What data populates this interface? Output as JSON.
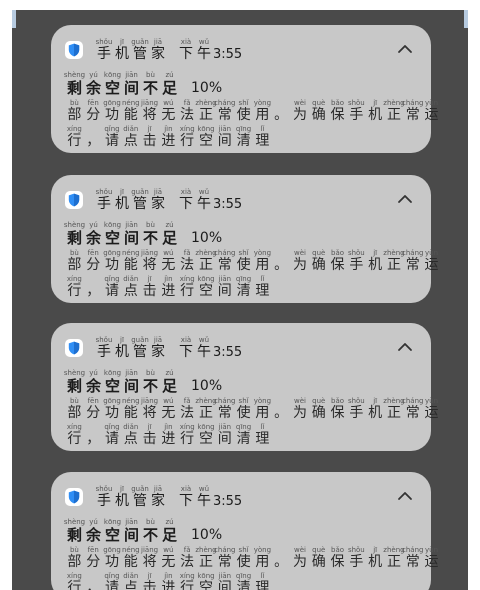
{
  "notifications": [
    {
      "app_name_chars": [
        {
          "py": "shǒu",
          "hz": "手"
        },
        {
          "py": "jī",
          "hz": "机"
        },
        {
          "py": "guǎn",
          "hz": "管"
        },
        {
          "py": "jiā",
          "hz": "家"
        }
      ],
      "time_prefix_chars": [
        {
          "py": "xià",
          "hz": "下"
        },
        {
          "py": "wǔ",
          "hz": "午"
        }
      ],
      "time": "3:55",
      "title_chars": [
        {
          "py": "shèng",
          "hz": "剩"
        },
        {
          "py": "yú",
          "hz": "余"
        },
        {
          "py": "kōng",
          "hz": "空"
        },
        {
          "py": "jiān",
          "hz": "间"
        },
        {
          "py": "bù",
          "hz": "不"
        },
        {
          "py": "zú",
          "hz": "足"
        }
      ],
      "title_value": "10%",
      "body_line1": [
        {
          "py": "bù",
          "hz": "部"
        },
        {
          "py": "fēn",
          "hz": "分"
        },
        {
          "py": "gōng",
          "hz": "功"
        },
        {
          "py": "néng",
          "hz": "能"
        },
        {
          "py": "jiāng",
          "hz": "将"
        },
        {
          "py": "wú",
          "hz": "无"
        },
        {
          "py": "fǎ",
          "hz": "法"
        },
        {
          "py": "zhèng",
          "hz": "正"
        },
        {
          "py": "cháng",
          "hz": "常"
        },
        {
          "py": "shǐ",
          "hz": "使"
        },
        {
          "py": "yòng",
          "hz": "用"
        },
        {
          "py": "",
          "hz": "。"
        },
        {
          "py": "wèi",
          "hz": "为"
        },
        {
          "py": "què",
          "hz": "确"
        },
        {
          "py": "bǎo",
          "hz": "保"
        },
        {
          "py": "shǒu",
          "hz": "手"
        },
        {
          "py": "jī",
          "hz": "机"
        },
        {
          "py": "zhèng",
          "hz": "正"
        },
        {
          "py": "cháng",
          "hz": "常"
        },
        {
          "py": "yùn",
          "hz": "运"
        }
      ],
      "body_line2": [
        {
          "py": "xíng",
          "hz": "行"
        },
        {
          "py": "",
          "hz": "，"
        },
        {
          "py": "qǐng",
          "hz": "请"
        },
        {
          "py": "diǎn",
          "hz": "点"
        },
        {
          "py": "jī",
          "hz": "击"
        },
        {
          "py": "jìn",
          "hz": "进"
        },
        {
          "py": "xíng",
          "hz": "行"
        },
        {
          "py": "kōng",
          "hz": "空"
        },
        {
          "py": "jiān",
          "hz": "间"
        },
        {
          "py": "qīng",
          "hz": "清"
        },
        {
          "py": "lǐ",
          "hz": "理"
        }
      ]
    },
    {
      "app_name_chars": [
        {
          "py": "shǒu",
          "hz": "手"
        },
        {
          "py": "jī",
          "hz": "机"
        },
        {
          "py": "guǎn",
          "hz": "管"
        },
        {
          "py": "jiā",
          "hz": "家"
        }
      ],
      "time_prefix_chars": [
        {
          "py": "xià",
          "hz": "下"
        },
        {
          "py": "wǔ",
          "hz": "午"
        }
      ],
      "time": "3:55",
      "title_chars": [
        {
          "py": "shèng",
          "hz": "剩"
        },
        {
          "py": "yú",
          "hz": "余"
        },
        {
          "py": "kōng",
          "hz": "空"
        },
        {
          "py": "jiān",
          "hz": "间"
        },
        {
          "py": "bù",
          "hz": "不"
        },
        {
          "py": "zú",
          "hz": "足"
        }
      ],
      "title_value": "10%",
      "body_line1": [
        {
          "py": "bù",
          "hz": "部"
        },
        {
          "py": "fēn",
          "hz": "分"
        },
        {
          "py": "gōng",
          "hz": "功"
        },
        {
          "py": "néng",
          "hz": "能"
        },
        {
          "py": "jiāng",
          "hz": "将"
        },
        {
          "py": "wú",
          "hz": "无"
        },
        {
          "py": "fǎ",
          "hz": "法"
        },
        {
          "py": "zhèng",
          "hz": "正"
        },
        {
          "py": "cháng",
          "hz": "常"
        },
        {
          "py": "shǐ",
          "hz": "使"
        },
        {
          "py": "yòng",
          "hz": "用"
        },
        {
          "py": "",
          "hz": "。"
        },
        {
          "py": "wèi",
          "hz": "为"
        },
        {
          "py": "què",
          "hz": "确"
        },
        {
          "py": "bǎo",
          "hz": "保"
        },
        {
          "py": "shǒu",
          "hz": "手"
        },
        {
          "py": "jī",
          "hz": "机"
        },
        {
          "py": "zhèng",
          "hz": "正"
        },
        {
          "py": "cháng",
          "hz": "常"
        },
        {
          "py": "yùn",
          "hz": "运"
        }
      ],
      "body_line2": [
        {
          "py": "xíng",
          "hz": "行"
        },
        {
          "py": "",
          "hz": "，"
        },
        {
          "py": "qǐng",
          "hz": "请"
        },
        {
          "py": "diǎn",
          "hz": "点"
        },
        {
          "py": "jī",
          "hz": "击"
        },
        {
          "py": "jìn",
          "hz": "进"
        },
        {
          "py": "xíng",
          "hz": "行"
        },
        {
          "py": "kōng",
          "hz": "空"
        },
        {
          "py": "jiān",
          "hz": "间"
        },
        {
          "py": "qīng",
          "hz": "清"
        },
        {
          "py": "lǐ",
          "hz": "理"
        }
      ]
    },
    {
      "app_name_chars": [
        {
          "py": "shǒu",
          "hz": "手"
        },
        {
          "py": "jī",
          "hz": "机"
        },
        {
          "py": "guǎn",
          "hz": "管"
        },
        {
          "py": "jiā",
          "hz": "家"
        }
      ],
      "time_prefix_chars": [
        {
          "py": "xià",
          "hz": "下"
        },
        {
          "py": "wǔ",
          "hz": "午"
        }
      ],
      "time": "3:55",
      "title_chars": [
        {
          "py": "shèng",
          "hz": "剩"
        },
        {
          "py": "yú",
          "hz": "余"
        },
        {
          "py": "kōng",
          "hz": "空"
        },
        {
          "py": "jiān",
          "hz": "间"
        },
        {
          "py": "bù",
          "hz": "不"
        },
        {
          "py": "zú",
          "hz": "足"
        }
      ],
      "title_value": "10%",
      "body_line1": [
        {
          "py": "bù",
          "hz": "部"
        },
        {
          "py": "fēn",
          "hz": "分"
        },
        {
          "py": "gōng",
          "hz": "功"
        },
        {
          "py": "néng",
          "hz": "能"
        },
        {
          "py": "jiāng",
          "hz": "将"
        },
        {
          "py": "wú",
          "hz": "无"
        },
        {
          "py": "fǎ",
          "hz": "法"
        },
        {
          "py": "zhèng",
          "hz": "正"
        },
        {
          "py": "cháng",
          "hz": "常"
        },
        {
          "py": "shǐ",
          "hz": "使"
        },
        {
          "py": "yòng",
          "hz": "用"
        },
        {
          "py": "",
          "hz": "。"
        },
        {
          "py": "wèi",
          "hz": "为"
        },
        {
          "py": "què",
          "hz": "确"
        },
        {
          "py": "bǎo",
          "hz": "保"
        },
        {
          "py": "shǒu",
          "hz": "手"
        },
        {
          "py": "jī",
          "hz": "机"
        },
        {
          "py": "zhèng",
          "hz": "正"
        },
        {
          "py": "cháng",
          "hz": "常"
        },
        {
          "py": "yùn",
          "hz": "运"
        }
      ],
      "body_line2": [
        {
          "py": "xíng",
          "hz": "行"
        },
        {
          "py": "",
          "hz": "，"
        },
        {
          "py": "qǐng",
          "hz": "请"
        },
        {
          "py": "diǎn",
          "hz": "点"
        },
        {
          "py": "jī",
          "hz": "击"
        },
        {
          "py": "jìn",
          "hz": "进"
        },
        {
          "py": "xíng",
          "hz": "行"
        },
        {
          "py": "kōng",
          "hz": "空"
        },
        {
          "py": "jiān",
          "hz": "间"
        },
        {
          "py": "qīng",
          "hz": "清"
        },
        {
          "py": "lǐ",
          "hz": "理"
        }
      ]
    },
    {
      "app_name_chars": [
        {
          "py": "shǒu",
          "hz": "手"
        },
        {
          "py": "jī",
          "hz": "机"
        },
        {
          "py": "guǎn",
          "hz": "管"
        },
        {
          "py": "jiā",
          "hz": "家"
        }
      ],
      "time_prefix_chars": [
        {
          "py": "xià",
          "hz": "下"
        },
        {
          "py": "wǔ",
          "hz": "午"
        }
      ],
      "time": "3:55",
      "title_chars": [
        {
          "py": "shèng",
          "hz": "剩"
        },
        {
          "py": "yú",
          "hz": "余"
        },
        {
          "py": "kōng",
          "hz": "空"
        },
        {
          "py": "jiān",
          "hz": "间"
        },
        {
          "py": "bù",
          "hz": "不"
        },
        {
          "py": "zú",
          "hz": "足"
        }
      ],
      "title_value": "10%",
      "body_line1": [
        {
          "py": "bù",
          "hz": "部"
        },
        {
          "py": "fēn",
          "hz": "分"
        },
        {
          "py": "gōng",
          "hz": "功"
        },
        {
          "py": "néng",
          "hz": "能"
        },
        {
          "py": "jiāng",
          "hz": "将"
        },
        {
          "py": "wú",
          "hz": "无"
        },
        {
          "py": "fǎ",
          "hz": "法"
        },
        {
          "py": "zhèng",
          "hz": "正"
        },
        {
          "py": "cháng",
          "hz": "常"
        },
        {
          "py": "shǐ",
          "hz": "使"
        },
        {
          "py": "yòng",
          "hz": "用"
        },
        {
          "py": "",
          "hz": "。"
        },
        {
          "py": "wèi",
          "hz": "为"
        },
        {
          "py": "què",
          "hz": "确"
        },
        {
          "py": "bǎo",
          "hz": "保"
        },
        {
          "py": "shǒu",
          "hz": "手"
        },
        {
          "py": "jī",
          "hz": "机"
        },
        {
          "py": "zhèng",
          "hz": "正"
        },
        {
          "py": "cháng",
          "hz": "常"
        },
        {
          "py": "yùn",
          "hz": "运"
        }
      ],
      "body_line2": [
        {
          "py": "xíng",
          "hz": "行"
        },
        {
          "py": "",
          "hz": "，"
        },
        {
          "py": "qǐng",
          "hz": "请"
        },
        {
          "py": "diǎn",
          "hz": "点"
        },
        {
          "py": "jī",
          "hz": "击"
        },
        {
          "py": "jìn",
          "hz": "进"
        },
        {
          "py": "xíng",
          "hz": "行"
        },
        {
          "py": "kōng",
          "hz": "空"
        },
        {
          "py": "jiān",
          "hz": "间"
        },
        {
          "py": "qīng",
          "hz": "清"
        },
        {
          "py": "lǐ",
          "hz": "理"
        }
      ]
    }
  ],
  "icons": {
    "app_icon": "shield-icon",
    "expand_icon": "chevron-up-icon"
  },
  "colors": {
    "panel_background": "#4a4a4a",
    "card_background": "#c8c8c8",
    "shield_blue": "#2f8ef5"
  }
}
